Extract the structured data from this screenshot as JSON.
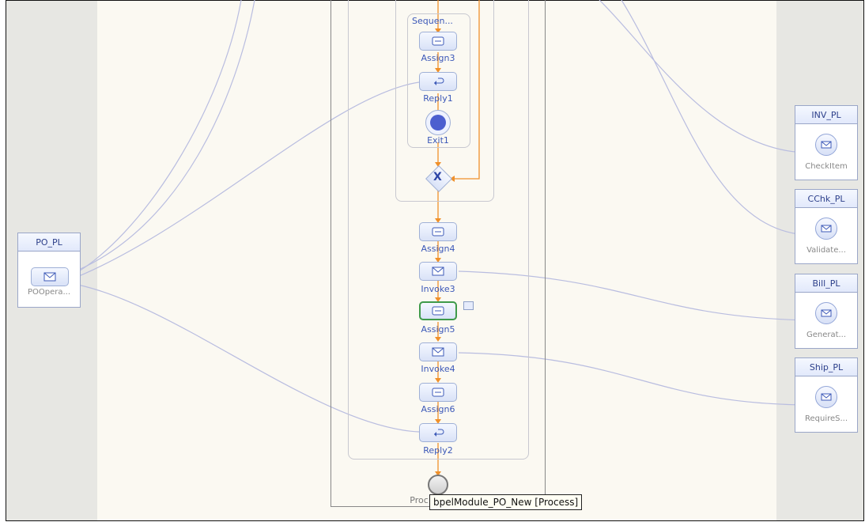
{
  "diagram": {
    "sequence_label": "Sequen...",
    "nodes": [
      {
        "id": "assign3",
        "label": "Assign3",
        "icon": "assign-icon"
      },
      {
        "id": "reply1",
        "label": "Reply1",
        "icon": "reply-icon"
      },
      {
        "id": "exit1",
        "label": "Exit1",
        "icon": "exit-icon"
      },
      {
        "id": "assign4",
        "label": "Assign4",
        "icon": "assign-icon"
      },
      {
        "id": "invoke3",
        "label": "Invoke3",
        "icon": "envelope-icon"
      },
      {
        "id": "assign5",
        "label": "Assign5",
        "icon": "assign-icon"
      },
      {
        "id": "invoke4",
        "label": "Invoke4",
        "icon": "envelope-icon"
      },
      {
        "id": "assign6",
        "label": "Assign6",
        "icon": "assign-icon"
      },
      {
        "id": "reply2",
        "label": "Reply2",
        "icon": "reply-icon"
      },
      {
        "id": "process_end",
        "label": "Proc",
        "icon": "end-icon"
      }
    ],
    "tooltip": "bpelModule_PO_New [Process]"
  },
  "partner_links": {
    "left": [
      {
        "name": "PO_PL",
        "operation": "POOpera..."
      }
    ],
    "right": [
      {
        "name": "INV_PL",
        "operation": "CheckItem"
      },
      {
        "name": "CChk_PL",
        "operation": "Validate..."
      },
      {
        "name": "Bill_PL",
        "operation": "Generat..."
      },
      {
        "name": "Ship_PL",
        "operation": "RequireS..."
      }
    ]
  },
  "colors": {
    "flow": "#f0902a",
    "wire": "#b9bde0",
    "lane": "#e7e7e3",
    "canvas": "#fbf9f2",
    "selected": "#3e9a4a"
  }
}
